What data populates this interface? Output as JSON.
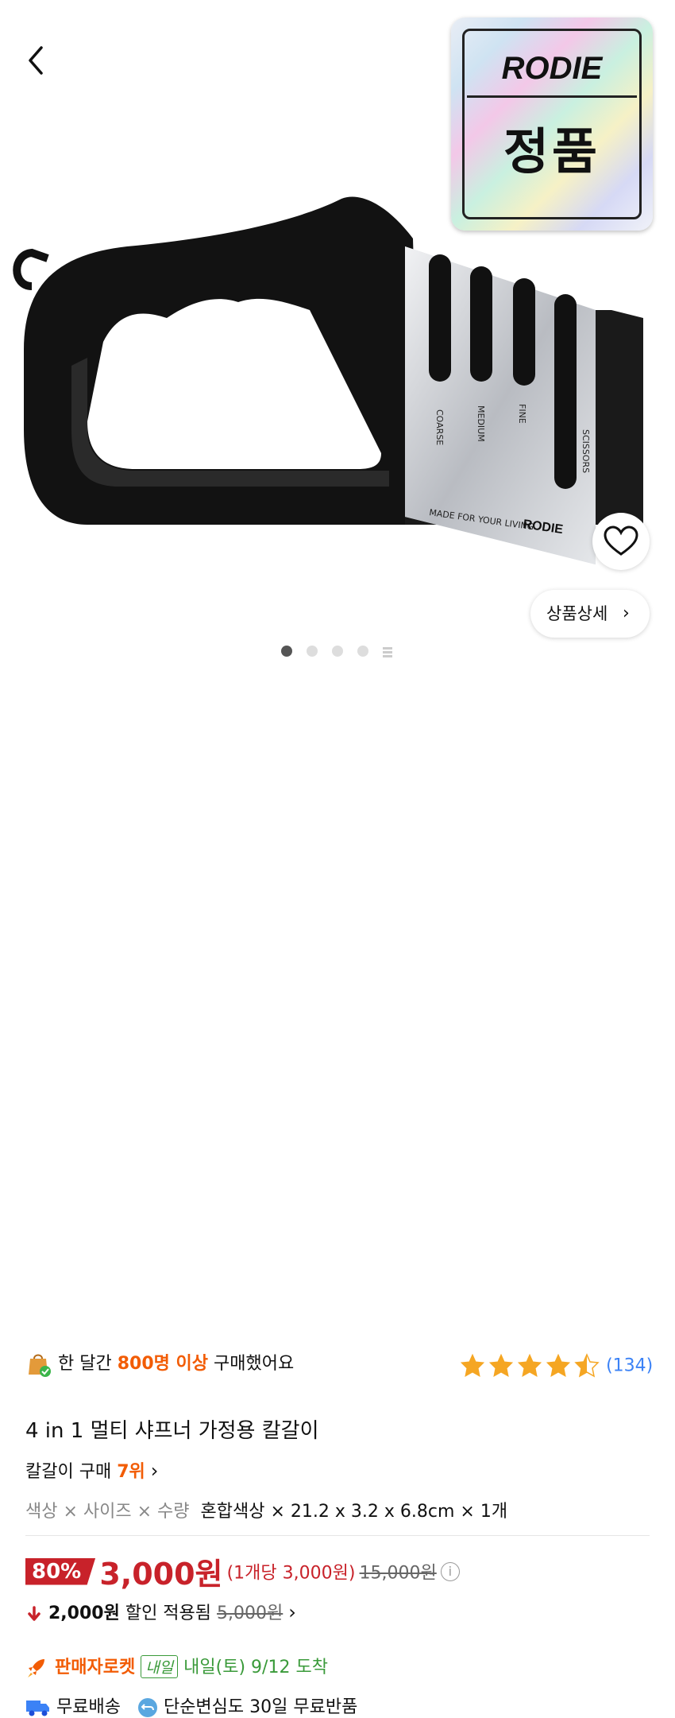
{
  "header": {
    "back_label": "뒤로"
  },
  "badge": {
    "brand": "RODIE",
    "text": "정품"
  },
  "product_image": {
    "slot_labels": [
      "COARSE",
      "MEDIUM",
      "FINE",
      "SCISSORS"
    ],
    "plate_text": "MADE FOR YOUR LIVING",
    "plate_brand": "RODIE"
  },
  "detail_button": {
    "label": "상품상세",
    "chevron": "›"
  },
  "carousel": {
    "count": 4,
    "active": 0
  },
  "purchase": {
    "prefix": "한 달간",
    "highlight": "800명 이상",
    "suffix": "구매했어요"
  },
  "rating": {
    "stars": 4.5,
    "count": "(134)"
  },
  "title": "4 in 1 멀티 샤프너 가정용 칼갈이",
  "rank": {
    "prefix": "칼갈이 구매",
    "rank": "7위",
    "chevron": "›"
  },
  "option": {
    "label": "색상 × 사이즈 × 수량",
    "value": "혼합색상 × 21.2 x 3.2 x 6.8cm × 1개"
  },
  "price": {
    "discount": "80%",
    "price": "3,000원",
    "unit_price": "(1개당 3,000원)",
    "original": "15,000원",
    "info_icon": "i"
  },
  "coupon": {
    "amount": "2,000원",
    "text": "할인 적용됨",
    "original": "5,000원",
    "chevron": "›"
  },
  "delivery": {
    "badge": "판매자로켓",
    "tag": "내일",
    "arrival": "내일(토) 9/12 도착"
  },
  "shipping": {
    "free": "무료배송",
    "return": "단순변심도 30일 무료반품"
  },
  "colors": {
    "accent": "#f25c05",
    "discount": "#c8222a",
    "rating": "#3b82f6",
    "star": "#f5a623"
  }
}
